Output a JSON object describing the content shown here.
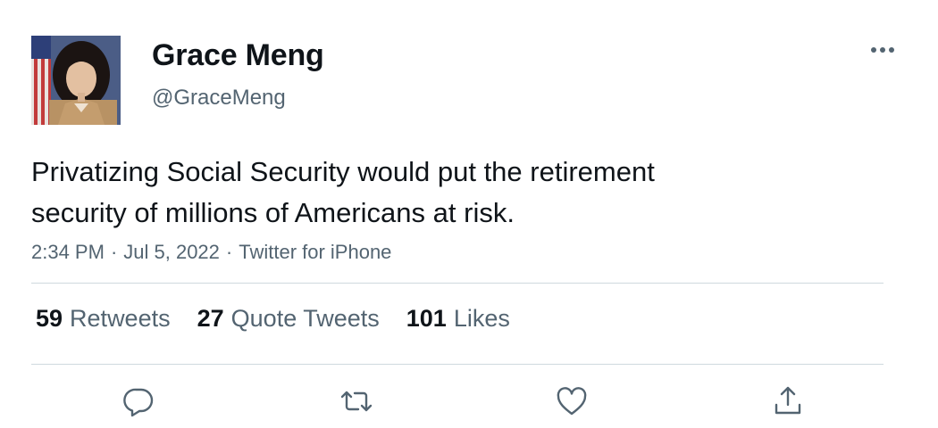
{
  "author": {
    "name": "Grace Meng",
    "handle": "@GraceMeng"
  },
  "tweet": {
    "text_line1": "Privatizing Social Security would put the retirement",
    "text_line2": "security of millions of Americans at risk.",
    "time": "2:34 PM",
    "date": "Jul 5, 2022",
    "source": "Twitter for iPhone",
    "separator": "·"
  },
  "stats": {
    "retweets_count": "59",
    "retweets_label": "Retweets",
    "quotes_count": "27",
    "quotes_label": "Quote Tweets",
    "likes_count": "101",
    "likes_label": "Likes"
  },
  "icons": {
    "more": "more-horizontal-icon",
    "reply": "reply-icon",
    "retweet": "retweet-icon",
    "like": "heart-icon",
    "share": "share-icon"
  },
  "colors": {
    "text_primary": "#0f1419",
    "text_secondary": "#536471",
    "divider": "#cfd9de"
  }
}
